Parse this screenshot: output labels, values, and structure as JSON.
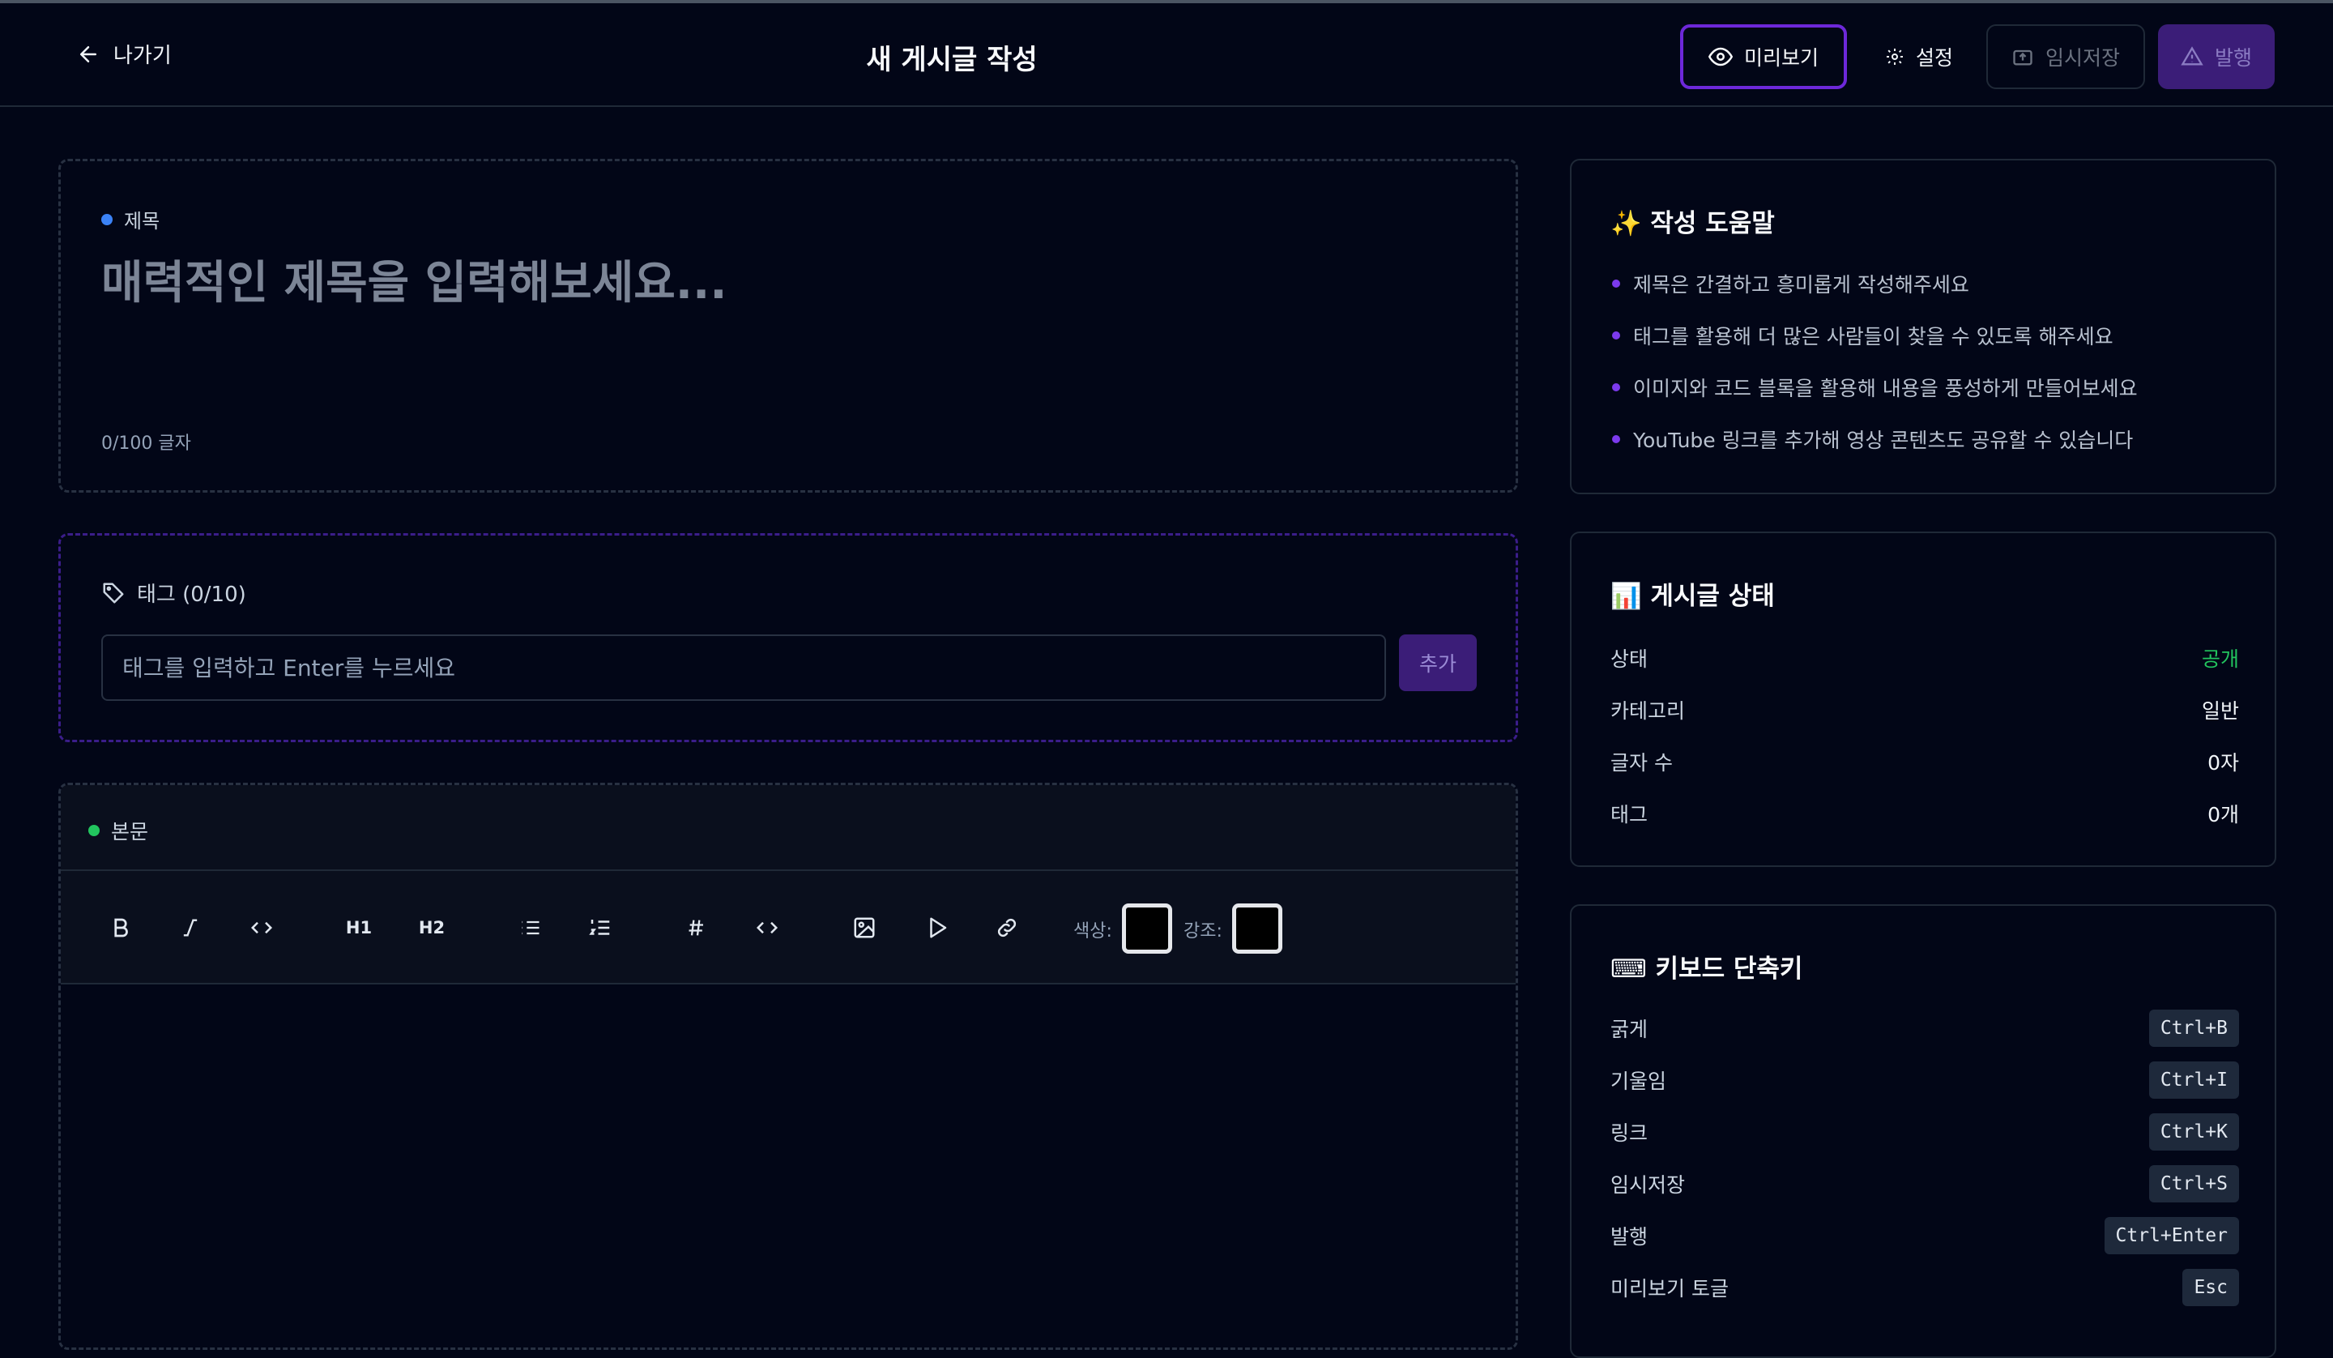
{
  "header": {
    "back_label": "나가기",
    "title": "새 게시글 작성",
    "preview_label": "미리보기",
    "settings_label": "설정",
    "draft_label": "임시저장",
    "publish_label": "발행"
  },
  "title_section": {
    "label": "제목",
    "placeholder": "매력적인 제목을 입력해보세요...",
    "value": "",
    "char_count": "0/100 글자"
  },
  "tags_section": {
    "label": "태그 (0/10)",
    "placeholder": "태그를 입력하고 Enter를 누르세요",
    "add_label": "추가"
  },
  "body_section": {
    "label": "본문",
    "toolbar": {
      "h1": "H1",
      "h2": "H2",
      "color_label": "색상:",
      "highlight_label": "강조:",
      "color_value": "#000000",
      "highlight_value": "#000000"
    }
  },
  "help": {
    "title": "✨ 작성 도움말",
    "tips": [
      "제목은 간결하고 흥미롭게 작성해주세요",
      "태그를 활용해 더 많은 사람들이 찾을 수 있도록 해주세요",
      "이미지와 코드 블록을 활용해 내용을 풍성하게 만들어보세요",
      "YouTube 링크를 추가해 영상 콘텐츠도 공유할 수 있습니다"
    ]
  },
  "status": {
    "title": "📊 게시글 상태",
    "rows": [
      {
        "label": "상태",
        "value": "공개"
      },
      {
        "label": "카테고리",
        "value": "일반"
      },
      {
        "label": "글자 수",
        "value": "0자"
      },
      {
        "label": "태그",
        "value": "0개"
      }
    ]
  },
  "shortcuts": {
    "title": "⌨ 키보드 단축키",
    "rows": [
      {
        "label": "굵게",
        "key": "Ctrl+B"
      },
      {
        "label": "기울임",
        "key": "Ctrl+I"
      },
      {
        "label": "링크",
        "key": "Ctrl+K"
      },
      {
        "label": "임시저장",
        "key": "Ctrl+S"
      },
      {
        "label": "발행",
        "key": "Ctrl+Enter"
      },
      {
        "label": "미리보기 토글",
        "key": "Esc"
      }
    ]
  },
  "colors": {
    "accent": "#6d28d9",
    "title_dot": "#3b82f6",
    "body_dot": "#22c55e",
    "status_public": "#22c55e",
    "background": "#020617"
  }
}
